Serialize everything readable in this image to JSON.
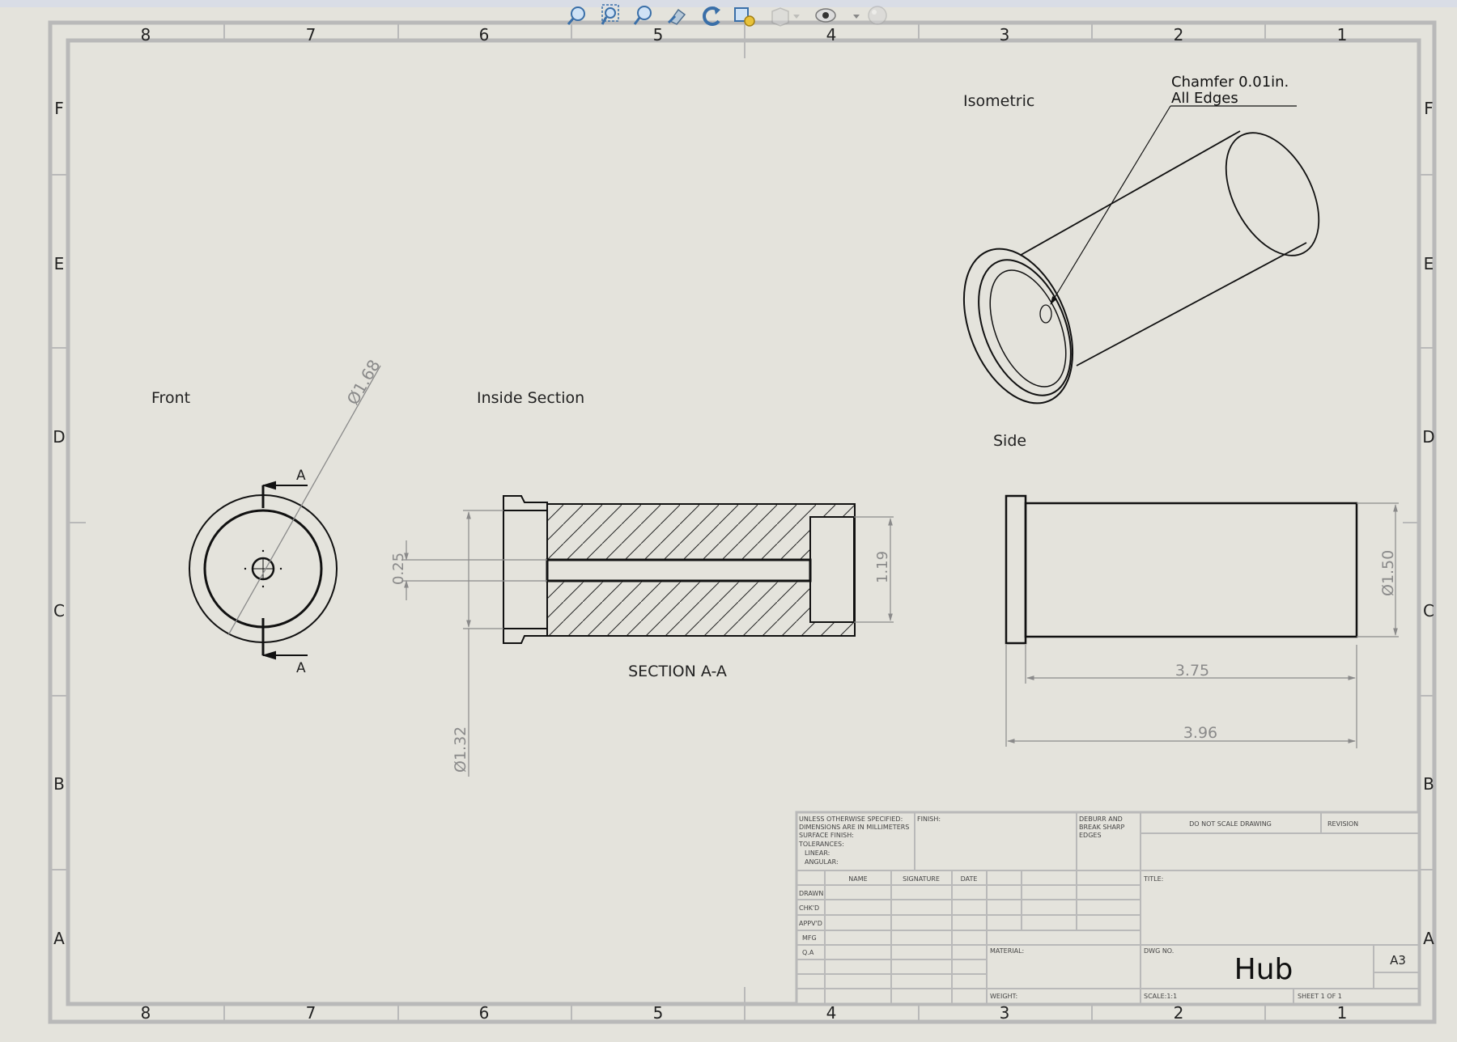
{
  "toolbar": {
    "icons": [
      "zoom-to-fit-icon",
      "zoom-to-area-icon",
      "zoom-in-out-icon",
      "previous-view-icon",
      "rotate-view-icon",
      "display-style-icon",
      "hide-show-items-icon",
      "view-settings-icon",
      "appearance-icon"
    ]
  },
  "sheet": {
    "columns": [
      "8",
      "7",
      "6",
      "5",
      "4",
      "3",
      "2",
      "1"
    ],
    "rows": [
      "F",
      "E",
      "D",
      "C",
      "B",
      "A"
    ]
  },
  "views": {
    "front": {
      "label": "Front",
      "diameter": "Ø1.68",
      "section_letter_top": "A",
      "section_letter_bottom": "A"
    },
    "section": {
      "label": "Inside Section",
      "caption": "SECTION A-A",
      "dim_bore": "0.25",
      "dim_counterbore": "1.19",
      "dim_flange_dia": "Ø1.32"
    },
    "side": {
      "label": "Side",
      "dim_dia": "Ø1.50",
      "dim_body_len": "3.75",
      "dim_total_len": "3.96"
    },
    "isometric": {
      "label": "Isometric",
      "note_line1": "Chamfer 0.01in.",
      "note_line2": "All Edges"
    }
  },
  "title_block": {
    "general_notes": [
      "UNLESS OTHERWISE SPECIFIED:",
      "DIMENSIONS ARE IN MILLIMETERS",
      "SURFACE FINISH:",
      "TOLERANCES:",
      "LINEAR:",
      "ANGULAR:"
    ],
    "finish_label": "FINISH:",
    "deburr": [
      "DEBURR AND",
      "BREAK SHARP",
      "EDGES"
    ],
    "do_not_scale": "DO NOT SCALE DRAWING",
    "revision_label": "REVISION",
    "col_name": "NAME",
    "col_signature": "SIGNATURE",
    "col_date": "DATE",
    "rows": [
      "DRAWN",
      "CHK'D",
      "APPV'D",
      "MFG",
      "Q.A"
    ],
    "title_label": "TITLE:",
    "material_label": "MATERIAL:",
    "dwg_no_label": "DWG NO.",
    "dwg_title": "Hub",
    "sheet_size": "A3",
    "weight_label": "WEIGHT:",
    "scale_label": "SCALE:1:1",
    "sheet_label": "SHEET 1 OF 1"
  }
}
